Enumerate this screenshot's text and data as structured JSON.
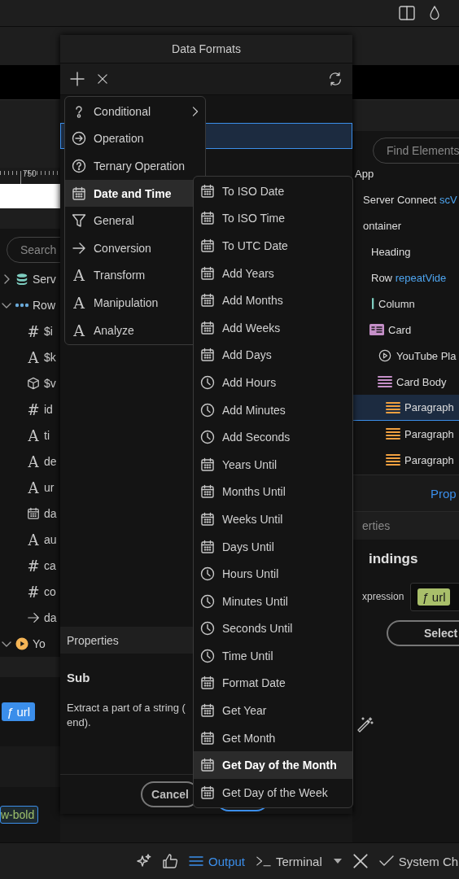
{
  "dialog": {
    "title": "Data Formats",
    "menu": [
      {
        "label": "Conditional",
        "kind": "hint",
        "arrow": true,
        "selected": false
      },
      {
        "label": "Operation",
        "kind": "arrow-circle",
        "arrow": false,
        "selected": false
      },
      {
        "label": "Ternary Operation",
        "kind": "question-circle",
        "arrow": false,
        "selected": false
      },
      {
        "label": "Date and Time",
        "kind": "calendar",
        "arrow": false,
        "selected": true
      },
      {
        "label": "General",
        "kind": "filter",
        "arrow": false,
        "selected": false
      },
      {
        "label": "Conversion",
        "kind": "arrow",
        "arrow": false,
        "selected": false
      },
      {
        "label": "Transform",
        "glyph": "A",
        "arrow": false,
        "selected": false
      },
      {
        "label": "Manipulation",
        "glyph": "A",
        "arrow": false,
        "selected": false
      },
      {
        "label": "Analyze",
        "glyph": "A",
        "arrow": false,
        "selected": false
      }
    ],
    "submenu": [
      {
        "label": "To ISO Date",
        "kind": "calendar",
        "selected": false
      },
      {
        "label": "To ISO Time",
        "kind": "calendar",
        "selected": false
      },
      {
        "label": "To UTC Date",
        "kind": "calendar",
        "selected": false
      },
      {
        "label": "Add Years",
        "kind": "calendar",
        "selected": false
      },
      {
        "label": "Add Months",
        "kind": "calendar",
        "selected": false
      },
      {
        "label": "Add Weeks",
        "kind": "calendar",
        "selected": false
      },
      {
        "label": "Add Days",
        "kind": "calendar",
        "selected": false
      },
      {
        "label": "Add Hours",
        "kind": "clock",
        "selected": false
      },
      {
        "label": "Add Minutes",
        "kind": "clock",
        "selected": false
      },
      {
        "label": "Add Seconds",
        "kind": "clock",
        "selected": false
      },
      {
        "label": "Years Until",
        "kind": "calendar",
        "selected": false
      },
      {
        "label": "Months Until",
        "kind": "calendar",
        "selected": false
      },
      {
        "label": "Weeks Until",
        "kind": "calendar",
        "selected": false
      },
      {
        "label": "Days Until",
        "kind": "calendar",
        "selected": false
      },
      {
        "label": "Hours Until",
        "kind": "clock",
        "selected": false
      },
      {
        "label": "Minutes Until",
        "kind": "clock",
        "selected": false
      },
      {
        "label": "Seconds Until",
        "kind": "clock",
        "selected": false
      },
      {
        "label": "Time Until",
        "kind": "clock",
        "selected": false
      },
      {
        "label": "Format Date",
        "kind": "calendar",
        "selected": false
      },
      {
        "label": "Get Year",
        "kind": "calendar",
        "selected": false
      },
      {
        "label": "Get Month",
        "kind": "calendar",
        "selected": false
      },
      {
        "label": "Get Day of the Month",
        "kind": "calendar",
        "selected": true
      },
      {
        "label": "Get Day of the Week",
        "kind": "calendar",
        "selected": false
      }
    ],
    "properties": {
      "header": "Properties",
      "name": "Sub",
      "description": "Extract a part of a string (\nend)."
    },
    "cancel": "Cancel"
  },
  "left_panel": {
    "ruler_label": "750",
    "search": {
      "placeholder": "Search"
    },
    "tree": [
      {
        "label": "Serv",
        "kind": "database",
        "expanded": false
      },
      {
        "label": "Row",
        "kind": "dots",
        "expanded": true,
        "children": [
          {
            "label": "$i",
            "glyph": "#"
          },
          {
            "label": "$k",
            "glyph": "A"
          },
          {
            "label": "$v",
            "kind": "cube"
          },
          {
            "label": "id",
            "glyph": "#"
          },
          {
            "label": "ti",
            "glyph": "A"
          },
          {
            "label": "de",
            "glyph": "A"
          },
          {
            "label": "ur",
            "glyph": "A"
          },
          {
            "label": "da",
            "kind": "calendar"
          },
          {
            "label": "au",
            "glyph": "A"
          },
          {
            "label": "ca",
            "glyph": "#"
          },
          {
            "label": "co",
            "glyph": "#"
          },
          {
            "label": "da",
            "kind": "arrow"
          }
        ]
      },
      {
        "label": "Yo",
        "kind": "play",
        "expanded": true
      }
    ],
    "url_chip": "*ƒ* url",
    "class_chip": "w-bold"
  },
  "right_panel": {
    "search": {
      "placeholder": "Find Elements"
    },
    "tree": [
      {
        "label": "App",
        "children": [
          {
            "label": "Server Connect",
            "ref": "scV"
          },
          {
            "label": "ontainer",
            "children": [
              {
                "label": "Heading"
              },
              {
                "label": "Row",
                "ref": "repeatVide",
                "children": [
                  {
                    "label": "Column",
                    "kind": "bar",
                    "children": [
                      {
                        "label": "Card",
                        "kind": "card",
                        "children": [
                          {
                            "label": "YouTube Pla",
                            "kind": "play-circle"
                          },
                          {
                            "label": "Card Body",
                            "kind": "lines-purple",
                            "children": [
                              {
                                "label": "Paragraph",
                                "kind": "lines-orange",
                                "selected": true
                              },
                              {
                                "label": "Paragraph",
                                "kind": "lines-orange",
                                "selected": false
                              },
                              {
                                "label": "Paragraph",
                                "kind": "lines-orange",
                                "selected": false
                              }
                            ]
                          }
                        ]
                      }
                    ]
                  }
                ]
              }
            ]
          }
        ]
      }
    ],
    "tab": "Prop",
    "section": "erties",
    "bindings": "indings",
    "expression_label": "xpression",
    "expression_chip": "*ƒ* url",
    "select_button": "Select"
  },
  "status_bar": {
    "items": [
      {
        "label": "Output",
        "kind": "list",
        "selected": true
      },
      {
        "label": "Terminal",
        "kind": "terminal",
        "selected": false
      },
      {
        "label": "System Ch",
        "kind": "check",
        "selected": false
      }
    ]
  }
}
